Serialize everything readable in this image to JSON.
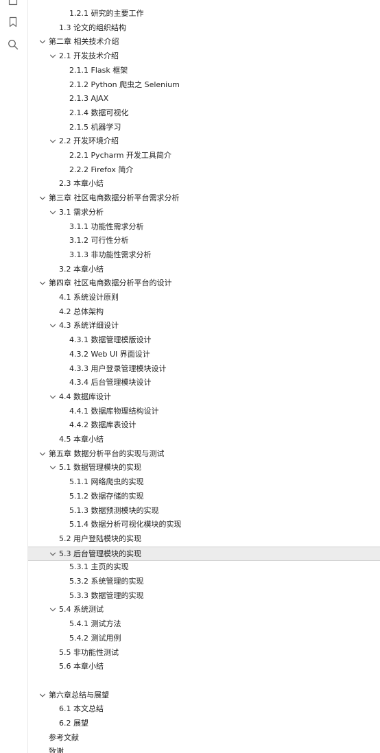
{
  "rail": {
    "icons": [
      "outline-icon",
      "bookmark-icon",
      "search-icon"
    ]
  },
  "outline": {
    "items": [
      {
        "label": "1.2.1 研究的主要工作",
        "level": 3
      },
      {
        "label": "1.3 论文的组织结构",
        "level": 2
      },
      {
        "label": "第二章 相关技术介绍",
        "level": 1,
        "expanded": true
      },
      {
        "label": "2.1 开发技术介绍",
        "level": 2,
        "expanded": true
      },
      {
        "label": "2.1.1 Flask 框架",
        "level": 3
      },
      {
        "label": "2.1.2 Python 爬虫之 Selenium",
        "level": 3
      },
      {
        "label": "2.1.3 AJAX",
        "level": 3
      },
      {
        "label": "2.1.4 数据可视化",
        "level": 3
      },
      {
        "label": "2.1.5 机器学习",
        "level": 3
      },
      {
        "label": "2.2 开发环境介绍",
        "level": 2,
        "expanded": true
      },
      {
        "label": "2.2.1 Pycharm 开发工具简介",
        "level": 3
      },
      {
        "label": "2.2.2 Firefox 简介",
        "level": 3
      },
      {
        "label": "2.3 本章小结",
        "level": 2
      },
      {
        "label": "第三章 社区电商数据分析平台需求分析",
        "level": 1,
        "expanded": true
      },
      {
        "label": "3.1 需求分析",
        "level": 2,
        "expanded": true
      },
      {
        "label": "3.1.1 功能性需求分析",
        "level": 3
      },
      {
        "label": "3.1.2 可行性分析",
        "level": 3
      },
      {
        "label": "3.1.3 非功能性需求分析",
        "level": 3
      },
      {
        "label": "3.2 本章小结",
        "level": 2
      },
      {
        "label": "第四章 社区电商数据分析平台的设计",
        "level": 1,
        "expanded": true
      },
      {
        "label": "4.1 系统设计原则",
        "level": 2
      },
      {
        "label": "4.2 总体架构",
        "level": 2
      },
      {
        "label": "4.3 系统详细设计",
        "level": 2,
        "expanded": true
      },
      {
        "label": "4.3.1 数据管理模版设计",
        "level": 3
      },
      {
        "label": "4.3.2 Web UI 界面设计",
        "level": 3
      },
      {
        "label": "4.3.3 用户登录管理模块设计",
        "level": 3
      },
      {
        "label": "4.3.4 后台管理模块设计",
        "level": 3
      },
      {
        "label": "4.4 数据库设计",
        "level": 2,
        "expanded": true
      },
      {
        "label": "4.4.1 数据库物理结构设计",
        "level": 3
      },
      {
        "label": "4.4.2 数据库表设计",
        "level": 3
      },
      {
        "label": "4.5 本章小结",
        "level": 2
      },
      {
        "label": "第五章 数据分析平台的实现与测试",
        "level": 1,
        "expanded": true
      },
      {
        "label": "5.1 数据管理模块的实现",
        "level": 2,
        "expanded": true
      },
      {
        "label": "5.1.1 网络爬虫的实现",
        "level": 3
      },
      {
        "label": "5.1.2 数据存储的实现",
        "level": 3
      },
      {
        "label": "5.1.3 数据预测模块的实现",
        "level": 3
      },
      {
        "label": "5.1.4 数据分析可视化模块的实现",
        "level": 3
      },
      {
        "label": "5.2 用户登陆模块的实现",
        "level": 2
      },
      {
        "label": "5.3 后台管理模块的实现",
        "level": 2,
        "expanded": true,
        "selected": true
      },
      {
        "label": "5.3.1 主页的实现",
        "level": 3
      },
      {
        "label": "5.3.2 系统管理的实现",
        "level": 3
      },
      {
        "label": "5.3.3 数据管理的实现",
        "level": 3
      },
      {
        "label": "5.4 系统测试",
        "level": 2,
        "expanded": true
      },
      {
        "label": "5.4.1 测试方法",
        "level": 3
      },
      {
        "label": "5.4.2 测试用例",
        "level": 3
      },
      {
        "label": "5.5 非功能性测试",
        "level": 2
      },
      {
        "label": "5.6 本章小结",
        "level": 2
      },
      {
        "label": "",
        "level": 2,
        "blank": true
      },
      {
        "label": "第六章总结与展望",
        "level": 1,
        "expanded": true
      },
      {
        "label": "6.1 本文总结",
        "level": 2
      },
      {
        "label": "6.2 展望",
        "level": 2
      },
      {
        "label": "参考文献",
        "level": 1,
        "leaf": true
      },
      {
        "label": "致谢",
        "level": 1,
        "leaf": true
      }
    ]
  }
}
